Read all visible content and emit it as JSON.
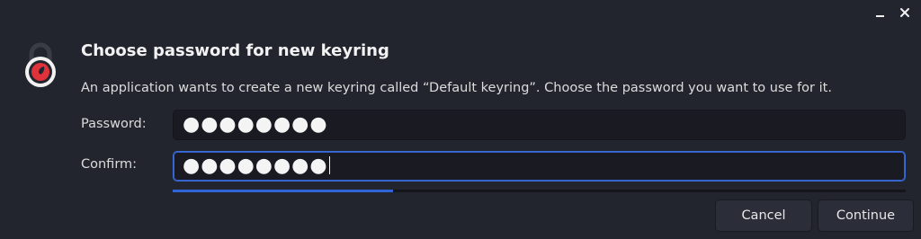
{
  "dialog": {
    "title": "Choose password for new keyring",
    "message": "An application wants to create a new keyring called “Default keyring”. Choose the password you want to use for it.",
    "password_label": "Password:",
    "password_value": "●●●●●●●●",
    "confirm_label": "Confirm:",
    "confirm_value": "●●●●●●●●",
    "strength_fraction": 0.3,
    "cancel_label": "Cancel",
    "continue_label": "Continue"
  },
  "icons": {
    "lock": "lock-icon",
    "minimize": "minimize-icon",
    "close": "close-icon"
  },
  "colors": {
    "background": "#22242e",
    "accent": "#2f63d6",
    "lock_red": "#e0323a"
  }
}
